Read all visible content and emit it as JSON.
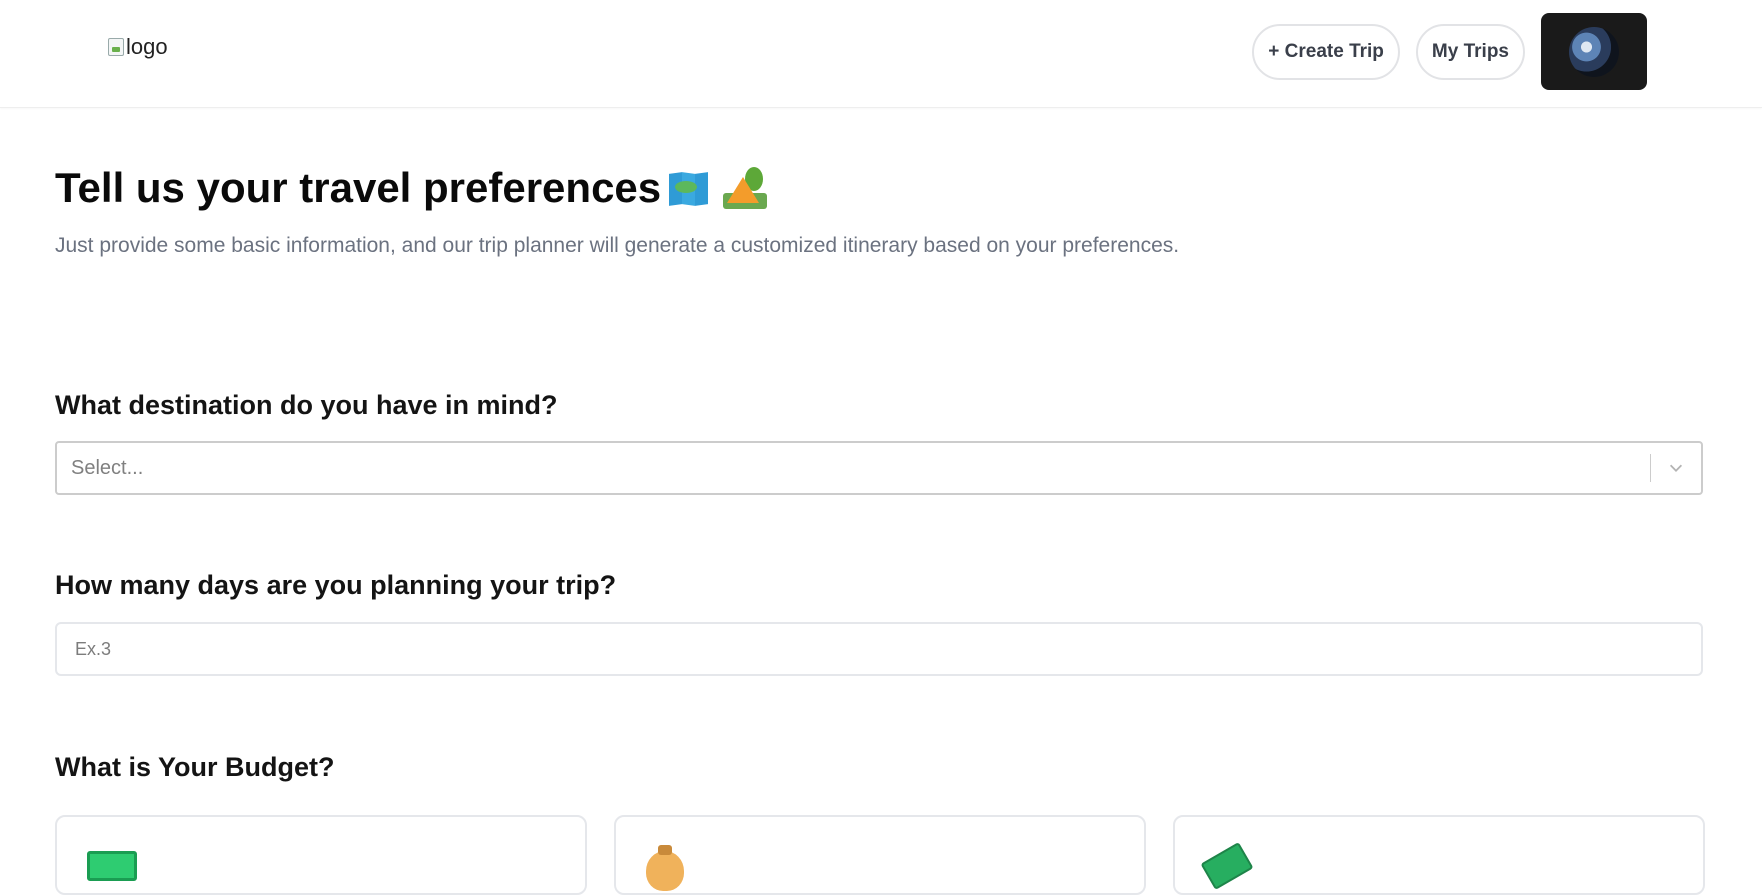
{
  "header": {
    "logo_alt": "logo",
    "nav": {
      "create_trip": "+ Create Trip",
      "my_trips": "My Trips"
    }
  },
  "main": {
    "title": "Tell us your travel preferences",
    "subtitle": "Just provide some basic information, and our trip planner will generate a customized itinerary based on your preferences.",
    "destination": {
      "question": "What destination do you have in mind?",
      "placeholder": "Select..."
    },
    "days": {
      "question": "How many days are you planning your trip?",
      "placeholder": "Ex.3"
    },
    "budget": {
      "question": "What is Your Budget?",
      "cards": [
        {
          "icon": "cash-icon"
        },
        {
          "icon": "money-bag-icon"
        },
        {
          "icon": "flying-money-icon"
        }
      ]
    }
  },
  "colors": {
    "avatar_button_bg": "#1a1a1a",
    "subtitle": "#6b7280",
    "border": "#e5e7eb"
  }
}
